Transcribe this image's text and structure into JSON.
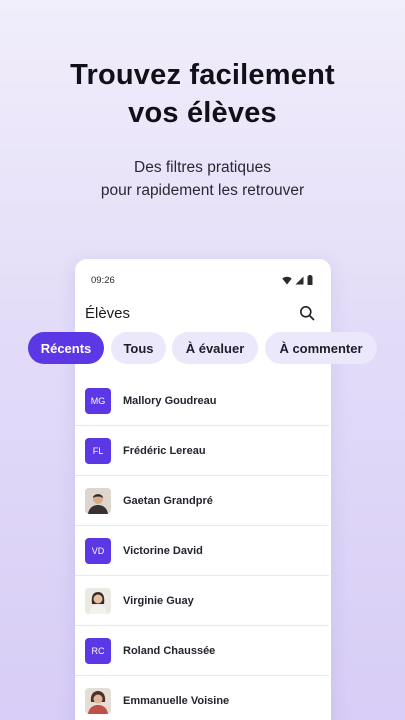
{
  "promo": {
    "headline_line1": "Trouvez facilement",
    "headline_line2": "vos élèves",
    "subline_line1": "Des filtres pratiques",
    "subline_line2": "pour rapidement les retrouver"
  },
  "status_bar": {
    "time": "09:26"
  },
  "app": {
    "title": "Élèves",
    "search_icon": "search-icon"
  },
  "filters": [
    {
      "label": "Récents",
      "active": true
    },
    {
      "label": "Tous",
      "active": false
    },
    {
      "label": "À évaluer",
      "active": false
    },
    {
      "label": "À commenter",
      "active": false
    }
  ],
  "students": [
    {
      "name": "Mallory Goudreau",
      "initials": "MG",
      "avatar": "initials"
    },
    {
      "name": "Frédéric Lereau",
      "initials": "FL",
      "avatar": "initials"
    },
    {
      "name": "Gaetan Grandpré",
      "initials": "",
      "avatar": "photo"
    },
    {
      "name": "Victorine David",
      "initials": "VD",
      "avatar": "initials"
    },
    {
      "name": "Virginie Guay",
      "initials": "",
      "avatar": "photo"
    },
    {
      "name": "Roland Chaussée",
      "initials": "RC",
      "avatar": "initials"
    },
    {
      "name": "Emmanuelle Voisine",
      "initials": "",
      "avatar": "photo"
    }
  ],
  "colors": {
    "accent": "#5b37e6",
    "chip_bg": "#ece8fb"
  }
}
